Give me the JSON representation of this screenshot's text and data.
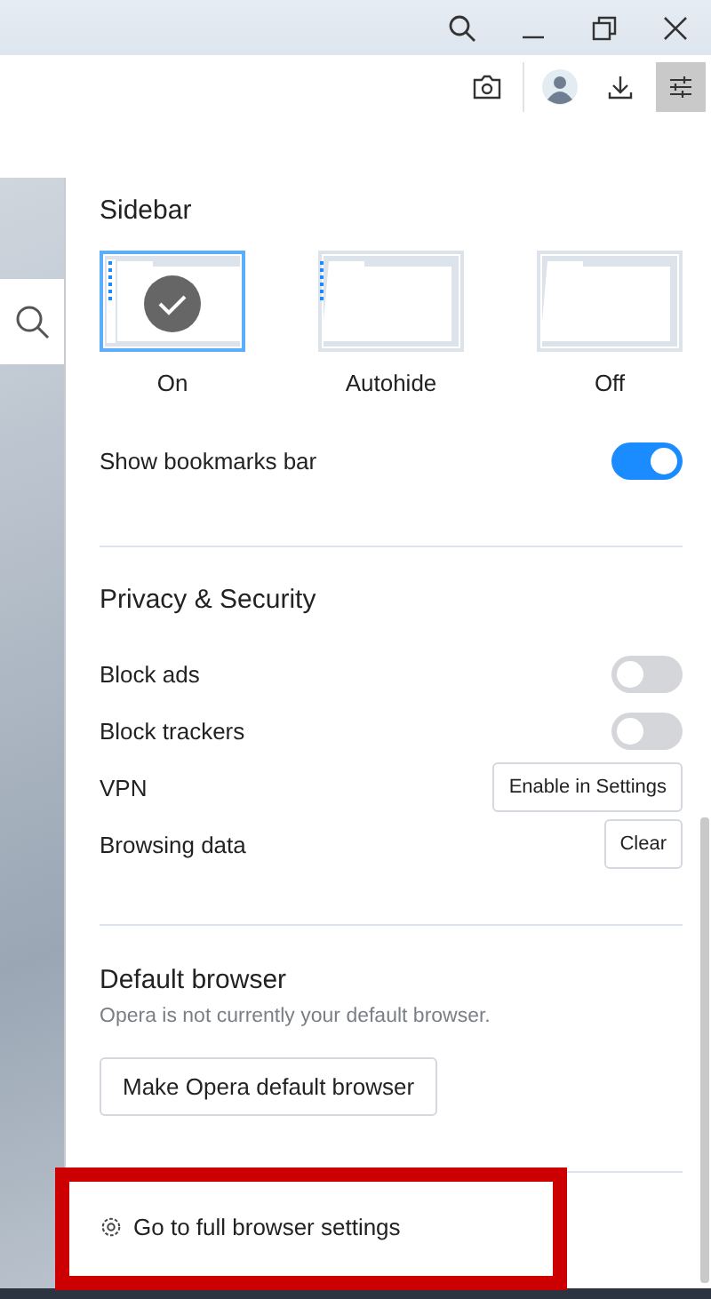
{
  "sidebar": {
    "title": "Sidebar",
    "options": [
      {
        "label": "On",
        "selected": true,
        "kind": "on"
      },
      {
        "label": "Autohide",
        "selected": false,
        "kind": "autohide"
      },
      {
        "label": "Off",
        "selected": false,
        "kind": "off"
      }
    ],
    "bookmarks_bar": {
      "label": "Show bookmarks bar",
      "on": true
    }
  },
  "privacy": {
    "title": "Privacy & Security",
    "rows": [
      {
        "kind": "toggle",
        "label": "Block ads",
        "on": false
      },
      {
        "kind": "toggle",
        "label": "Block trackers",
        "on": false
      },
      {
        "kind": "button",
        "label": "VPN",
        "button": "Enable in Settings"
      },
      {
        "kind": "button",
        "label": "Browsing data",
        "button": "Clear"
      }
    ]
  },
  "default_browser": {
    "title": "Default browser",
    "description": "Opera is not currently your default browser.",
    "button": "Make Opera default browser"
  },
  "footer_link": "Go to full browser settings"
}
